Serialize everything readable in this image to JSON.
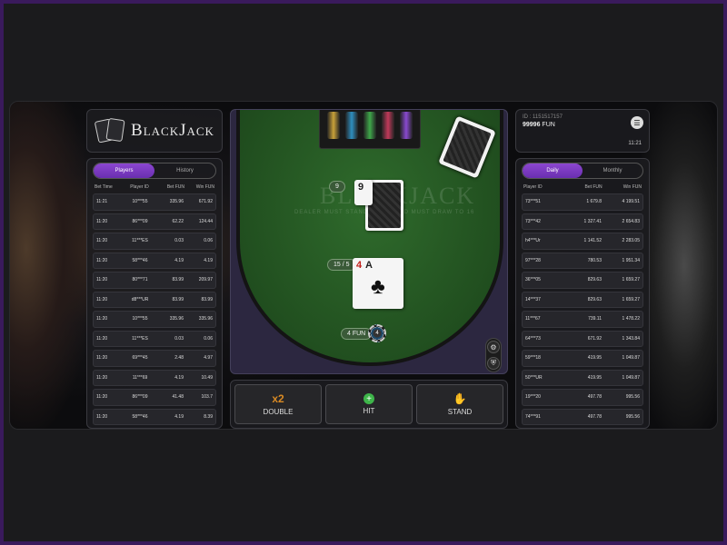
{
  "logo": {
    "text": "BlackJack"
  },
  "players_panel": {
    "tabs": [
      {
        "label": "Players"
      },
      {
        "label": "History"
      }
    ],
    "headers": [
      "Bet Time",
      "Player ID",
      "Bet  FUN",
      "Win  FUN"
    ],
    "rows": [
      [
        "11:21",
        "10***55",
        "335.96",
        "671.92"
      ],
      [
        "11:20",
        "86***09",
        "62.22",
        "124.44"
      ],
      [
        "11:20",
        "11***ES",
        "0.03",
        "0.06"
      ],
      [
        "11:20",
        "58***46",
        "4.19",
        "4.19"
      ],
      [
        "11:20",
        "80***71",
        "83.99",
        "209.97"
      ],
      [
        "11:20",
        "d8***UR",
        "83.99",
        "83.99"
      ],
      [
        "11:20",
        "10***55",
        "335.96",
        "335.96"
      ],
      [
        "11:20",
        "11***ES",
        "0.03",
        "0.06"
      ],
      [
        "11:20",
        "69***45",
        "2.48",
        "4.97"
      ],
      [
        "11:20",
        "11***69",
        "4.19",
        "10.49"
      ],
      [
        "11:20",
        "86***09",
        "41.48",
        "103.7"
      ],
      [
        "11:20",
        "58***46",
        "4.19",
        "8.39"
      ]
    ]
  },
  "table": {
    "felt_logo": "BLACKJACK",
    "felt_text": "DEALER MUST STAND TO 17, AND MUST DRAW TO 16",
    "dealer_score": "9",
    "dealer_card_rank": "9",
    "player_score": "15 / 5",
    "player_card_rank_1": "4",
    "player_card_rank_2": "A",
    "player_card_suit": "♣",
    "bet_amount": "4 FUN",
    "chip_value": "4"
  },
  "actions": {
    "double": {
      "icon": "x2",
      "label": "DOUBLE"
    },
    "hit": {
      "icon": "+",
      "label": "HIT"
    },
    "stand": {
      "icon": "✋",
      "label": "STAND"
    }
  },
  "account": {
    "id": "ID : 1151517157",
    "balance": "99996",
    "currency": "FUN",
    "time": "11:21"
  },
  "leaderboard": {
    "tabs": [
      {
        "label": "Daily"
      },
      {
        "label": "Monthly"
      }
    ],
    "headers": [
      "Player ID",
      "Bet  FUN",
      "Win  FUN"
    ],
    "rows": [
      [
        "73***51",
        "1 679.8",
        "4 199.51"
      ],
      [
        "73***42",
        "1 327.41",
        "2 654.83"
      ],
      [
        "h4***Ur",
        "1 141.52",
        "2 283.05"
      ],
      [
        "97***28",
        "780.53",
        "1 951.34"
      ],
      [
        "36***05",
        "829.63",
        "1 659.27"
      ],
      [
        "14***37",
        "829.63",
        "1 659.27"
      ],
      [
        "11***67",
        "739.11",
        "1 478.22"
      ],
      [
        "64***73",
        "671.92",
        "1 343.84"
      ],
      [
        "59***18",
        "419.95",
        "1 049.87"
      ],
      [
        "50***UR",
        "419.95",
        "1 049.87"
      ],
      [
        "19***20",
        "497.78",
        "995.56"
      ],
      [
        "74***91",
        "497.78",
        "995.56"
      ]
    ]
  },
  "colors": {
    "accent": "#7b3fc4",
    "felt": "#235321",
    "border_frame": "#3a1a5c"
  }
}
